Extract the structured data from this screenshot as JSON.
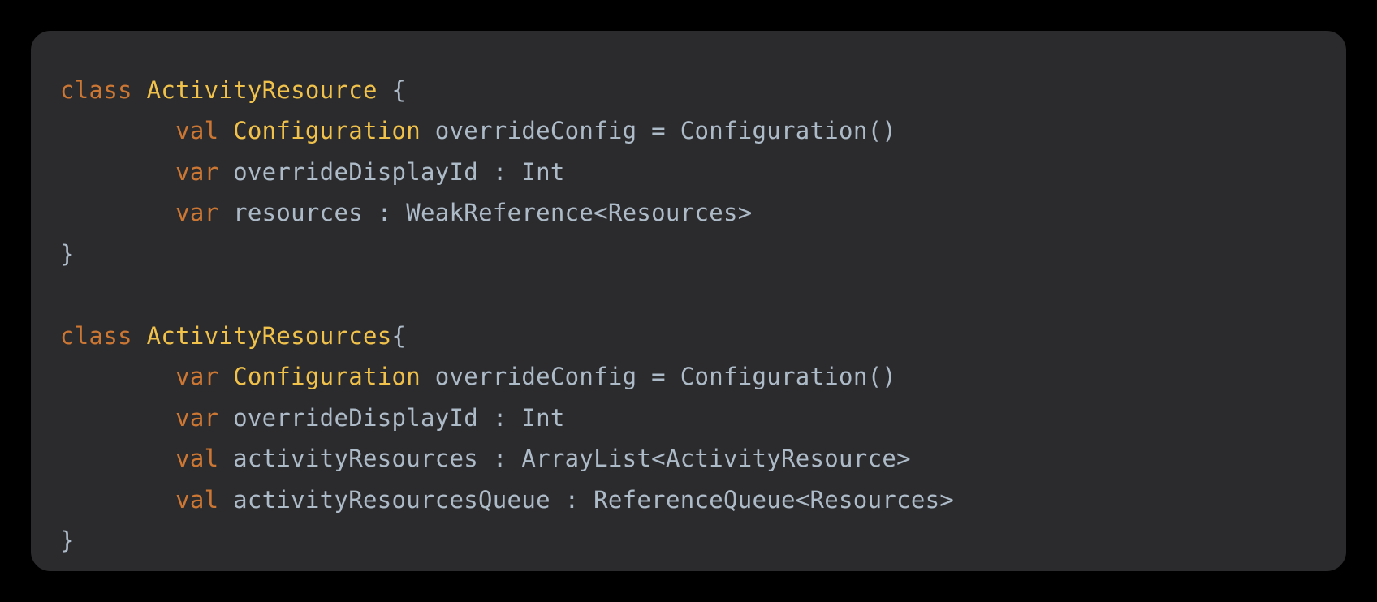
{
  "code": {
    "tokens": [
      {
        "cls": "kw",
        "t": "class"
      },
      {
        "cls": "",
        "t": " "
      },
      {
        "cls": "typename",
        "t": "ActivityResource"
      },
      {
        "cls": "",
        "t": " "
      },
      {
        "cls": "punct",
        "t": "{"
      },
      {
        "cls": "",
        "t": "\n        "
      },
      {
        "cls": "kw",
        "t": "val"
      },
      {
        "cls": "",
        "t": " "
      },
      {
        "cls": "typename",
        "t": "Configuration"
      },
      {
        "cls": "",
        "t": " "
      },
      {
        "cls": "ident",
        "t": "overrideConfig"
      },
      {
        "cls": "",
        "t": " "
      },
      {
        "cls": "op",
        "t": "="
      },
      {
        "cls": "",
        "t": " "
      },
      {
        "cls": "ident",
        "t": "Configuration()"
      },
      {
        "cls": "",
        "t": "\n        "
      },
      {
        "cls": "kw",
        "t": "var"
      },
      {
        "cls": "",
        "t": " "
      },
      {
        "cls": "ident",
        "t": "overrideDisplayId"
      },
      {
        "cls": "",
        "t": " "
      },
      {
        "cls": "punct",
        "t": ":"
      },
      {
        "cls": "",
        "t": " "
      },
      {
        "cls": "typeref",
        "t": "Int"
      },
      {
        "cls": "",
        "t": "\n        "
      },
      {
        "cls": "kw",
        "t": "var"
      },
      {
        "cls": "",
        "t": " "
      },
      {
        "cls": "ident",
        "t": "resources"
      },
      {
        "cls": "",
        "t": " "
      },
      {
        "cls": "punct",
        "t": ":"
      },
      {
        "cls": "",
        "t": " "
      },
      {
        "cls": "typeref",
        "t": "WeakReference<Resources>"
      },
      {
        "cls": "",
        "t": "\n"
      },
      {
        "cls": "punct",
        "t": "}"
      },
      {
        "cls": "",
        "t": "\n\n"
      },
      {
        "cls": "kw",
        "t": "class"
      },
      {
        "cls": "",
        "t": " "
      },
      {
        "cls": "typename",
        "t": "ActivityResources"
      },
      {
        "cls": "punct",
        "t": "{"
      },
      {
        "cls": "",
        "t": "\n        "
      },
      {
        "cls": "kw",
        "t": "var"
      },
      {
        "cls": "",
        "t": " "
      },
      {
        "cls": "typename",
        "t": "Configuration"
      },
      {
        "cls": "",
        "t": " "
      },
      {
        "cls": "ident",
        "t": "overrideConfig"
      },
      {
        "cls": "",
        "t": " "
      },
      {
        "cls": "op",
        "t": "="
      },
      {
        "cls": "",
        "t": " "
      },
      {
        "cls": "ident",
        "t": "Configuration()"
      },
      {
        "cls": "",
        "t": "\n        "
      },
      {
        "cls": "kw",
        "t": "var"
      },
      {
        "cls": "",
        "t": " "
      },
      {
        "cls": "ident",
        "t": "overrideDisplayId"
      },
      {
        "cls": "",
        "t": " "
      },
      {
        "cls": "punct",
        "t": ":"
      },
      {
        "cls": "",
        "t": " "
      },
      {
        "cls": "typeref",
        "t": "Int"
      },
      {
        "cls": "",
        "t": "\n        "
      },
      {
        "cls": "kw",
        "t": "val"
      },
      {
        "cls": "",
        "t": " "
      },
      {
        "cls": "ident",
        "t": "activityResources"
      },
      {
        "cls": "",
        "t": " "
      },
      {
        "cls": "punct",
        "t": ":"
      },
      {
        "cls": "",
        "t": " "
      },
      {
        "cls": "typeref",
        "t": "ArrayList<ActivityResource>"
      },
      {
        "cls": "",
        "t": "\n        "
      },
      {
        "cls": "kw",
        "t": "val"
      },
      {
        "cls": "",
        "t": " "
      },
      {
        "cls": "ident",
        "t": "activityResourcesQueue"
      },
      {
        "cls": "",
        "t": " "
      },
      {
        "cls": "punct",
        "t": ":"
      },
      {
        "cls": "",
        "t": " "
      },
      {
        "cls": "typeref",
        "t": "ReferenceQueue<Resources>"
      },
      {
        "cls": "",
        "t": "\n"
      },
      {
        "cls": "punct",
        "t": "}"
      }
    ]
  }
}
